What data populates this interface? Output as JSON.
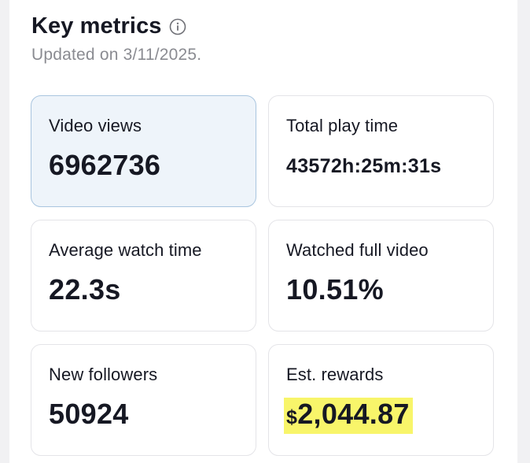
{
  "header": {
    "title": "Key metrics",
    "updated": "Updated on 3/11/2025."
  },
  "metrics": [
    {
      "label": "Video views",
      "value": "6962736"
    },
    {
      "label": "Total play time",
      "value": "43572h:25m:31s"
    },
    {
      "label": "Average watch time",
      "value": "22.3s"
    },
    {
      "label": "Watched full video",
      "value": "10.51%"
    },
    {
      "label": "New followers",
      "value": "50924"
    },
    {
      "label": "Est. rewards",
      "currency": "$",
      "value": "2,044.87"
    }
  ],
  "colors": {
    "selected_card_bg": "#eef4fa",
    "selected_card_border": "#a9c5df",
    "highlight": "#f8f56a",
    "muted_text": "#8a8b91"
  },
  "icons": {
    "info": "info-icon"
  }
}
